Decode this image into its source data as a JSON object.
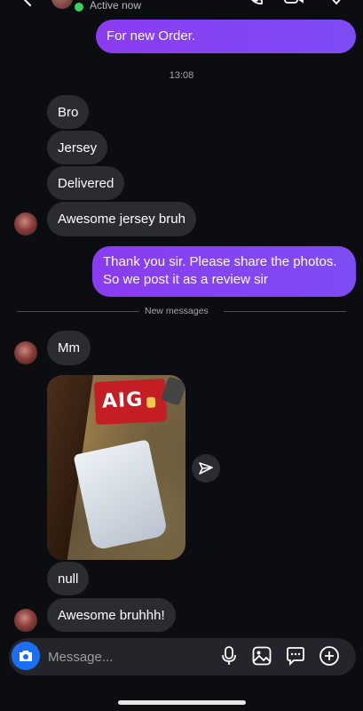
{
  "header": {
    "status_text": "Active now",
    "colors": {
      "online": "#3bd159"
    }
  },
  "messages": {
    "sent_1": "For new Order.",
    "timestamp": "13:08",
    "recv_1": "Bro",
    "recv_2": "Jersey",
    "recv_3": "Delivered",
    "recv_4": "Awesome jersey bruh",
    "sent_2_line1": "Thank you sir. Please share the photos.",
    "sent_2_line2": "So we post it as a review sir",
    "divider": "New messages",
    "recv_5": "Mm",
    "photo_text": "AIG",
    "recv_6": "null",
    "recv_7": "Awesome bruhhh!"
  },
  "composer": {
    "placeholder": "Message..."
  },
  "icons": [
    "back-icon",
    "phone-icon",
    "video-icon",
    "heart-icon",
    "share-icon",
    "camera-icon",
    "microphone-icon",
    "gallery-icon",
    "sticker-icon",
    "add-icon"
  ],
  "colors": {
    "background": "#0c0d10",
    "sent_bubble": "#8a3cf0",
    "received_bubble": "#2b2c30",
    "camera_button": "#1a6ff4"
  }
}
